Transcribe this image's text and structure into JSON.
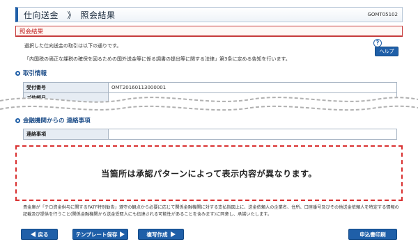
{
  "header": {
    "title": "仕向送金　》　照会結果",
    "screen_code": "GOMT05102"
  },
  "subheader": {
    "label": "照会結果"
  },
  "intro": {
    "line1": "選択した仕向送金の取引は以下の通りです。",
    "line2": "「内国税の適正な課税の確保を図るための国外送金等に係る調書の提出等に関する法律」第3条に定める告知を行います。"
  },
  "help": {
    "label": "ヘルプ",
    "q": "?"
  },
  "section_transaction": {
    "title": "取引情報",
    "rows": [
      {
        "label": "受付番号",
        "value": "OMT20160113000001"
      },
      {
        "label": "ご依頼日",
        "value": ""
      }
    ]
  },
  "section_bank": {
    "title": "金融機関からの 連絡事項",
    "rows": [
      {
        "label": "連絡事項",
        "value": ""
      }
    ]
  },
  "placeholder": {
    "text": "当箇所は承認パターンによって表示内容が異なります。"
  },
  "notice": {
    "text": "貴金庫が「テロ資金供与に関するFATF特別勧告」遵守の観点から必要に応じて関係金融機関に対する支払指図上に、送金依頼人の企業名、住所、口座番号及びその他送金依頼人を特定する情報の記載及び提供を行うこと(関係金融機関から送金受取人にも伝達される可能性があることを含みます)に同意し、承諾いたします。"
  },
  "buttons": {
    "back": "戻る",
    "template_save": "テンプレート保存",
    "copy_create": "複写作成",
    "print": "申込書印刷"
  },
  "colors": {
    "accent": "#1f5fa8",
    "alert": "#d93030"
  }
}
